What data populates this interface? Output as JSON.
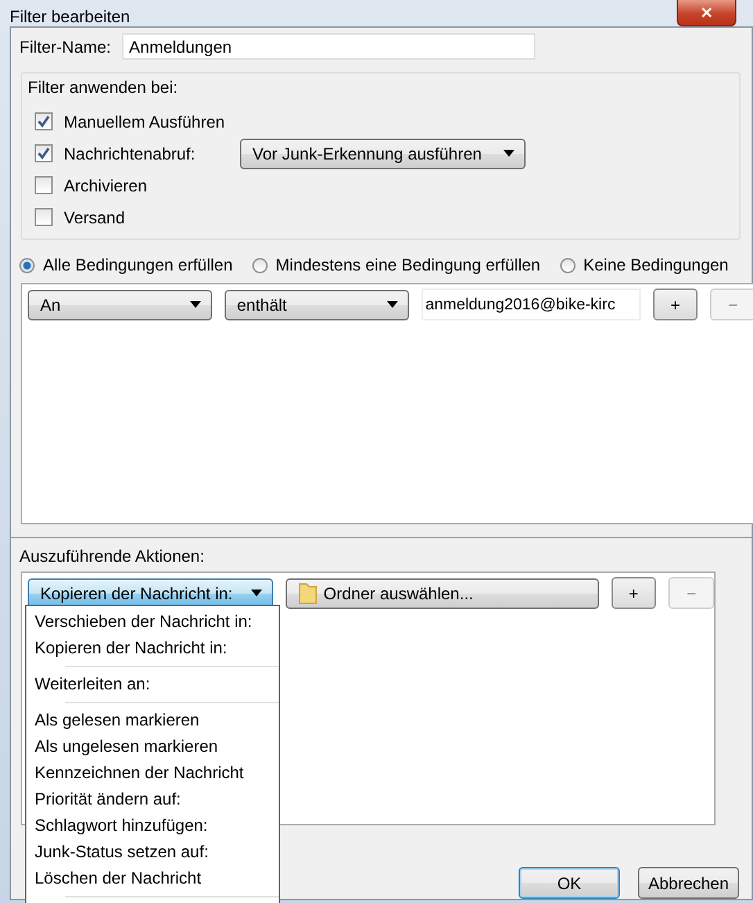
{
  "window": {
    "title": "Filter bearbeiten",
    "close_glyph": "✕"
  },
  "filter_name": {
    "label": "Filter-Name:",
    "value": "Anmeldungen"
  },
  "apply_group": {
    "title": "Filter anwenden bei:",
    "options": [
      {
        "label": "Manuellem Ausführen",
        "checked": true
      },
      {
        "label": "Nachrichtenabruf:",
        "checked": true,
        "dropdown": "Vor Junk-Erkennung ausführen"
      },
      {
        "label": "Archivieren",
        "checked": false
      },
      {
        "label": "Versand",
        "checked": false
      }
    ]
  },
  "match_mode": [
    {
      "label": "Alle Bedingungen erfüllen",
      "selected": true
    },
    {
      "label": "Mindestens eine Bedingung erfüllen",
      "selected": false
    },
    {
      "label": "Keine Bedingungen",
      "selected": false
    }
  ],
  "conditions": [
    {
      "field": "An",
      "operator": "enthält",
      "value": "anmeldung2016@bike-kirc",
      "add": "+",
      "remove": "−",
      "remove_disabled": true
    }
  ],
  "actions_label": "Auszuführende Aktionen:",
  "actions": [
    {
      "action": "Kopieren der Nachricht in:",
      "target": "Ordner auswählen...",
      "add": "+",
      "remove": "−",
      "remove_disabled": true
    }
  ],
  "action_menu": {
    "open": true,
    "groups": [
      [
        "Verschieben der Nachricht in:",
        "Kopieren der Nachricht in:"
      ],
      [
        "Weiterleiten an:"
      ],
      [
        "Als gelesen markieren",
        "Als ungelesen markieren",
        "Kennzeichnen der Nachricht",
        "Priorität ändern auf:",
        "Schlagwort hinzufügen:",
        "Junk-Status setzen auf:",
        "Löschen der Nachricht"
      ]
    ]
  },
  "buttons": [
    {
      "label": "OK",
      "default": true
    },
    {
      "label": "Abbrechen",
      "default": false
    }
  ]
}
